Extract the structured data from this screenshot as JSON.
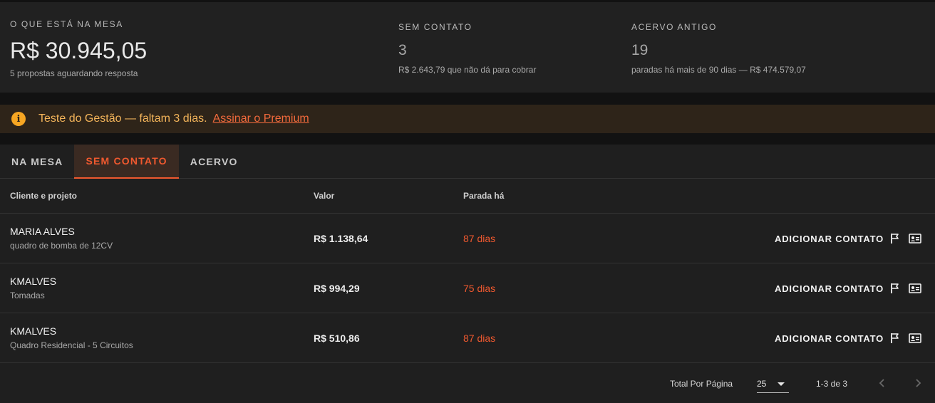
{
  "summary": {
    "na_mesa": {
      "label": "O QUE ESTÁ NA MESA",
      "value": "R$ 30.945,05",
      "sub": "5 propostas aguardando resposta"
    },
    "sem_contato": {
      "label": "SEM CONTATO",
      "value": "3",
      "sub": "R$ 2.643,79 que não dá para cobrar"
    },
    "acervo_antigo": {
      "label": "ACERVO ANTIGO",
      "value": "19",
      "sub": "paradas há mais de 90 dias — R$ 474.579,07"
    }
  },
  "banner": {
    "text": "Teste do Gestão — faltam 3 dias.",
    "link": "Assinar o Premium",
    "icon": "info-icon"
  },
  "tabs": [
    {
      "label": "NA MESA",
      "active": false
    },
    {
      "label": "SEM CONTATO",
      "active": true
    },
    {
      "label": "ACERVO",
      "active": false
    }
  ],
  "table": {
    "headers": {
      "client": "Cliente e projeto",
      "value": "Valor",
      "stopped": "Parada há"
    },
    "rows": [
      {
        "client": "MARIA ALVES",
        "project": "quadro de bomba de 12CV",
        "value": "R$ 1.138,64",
        "stopped": "87 dias",
        "action": "ADICIONAR CONTATO"
      },
      {
        "client": "KMALVES",
        "project": "Tomadas",
        "value": "R$ 994,29",
        "stopped": "75 dias",
        "action": "ADICIONAR CONTATO"
      },
      {
        "client": "KMALVES",
        "project": "Quadro Residencial - 5 Circuitos",
        "value": "R$ 510,86",
        "stopped": "87 dias",
        "action": "ADICIONAR CONTATO"
      }
    ]
  },
  "pagination": {
    "label": "Total Por Página",
    "per_page": "25",
    "range": "1-3 de 3"
  },
  "colors": {
    "accent": "#f0592f",
    "warning": "#f6a623",
    "surface": "#212121",
    "background": "#121212"
  }
}
